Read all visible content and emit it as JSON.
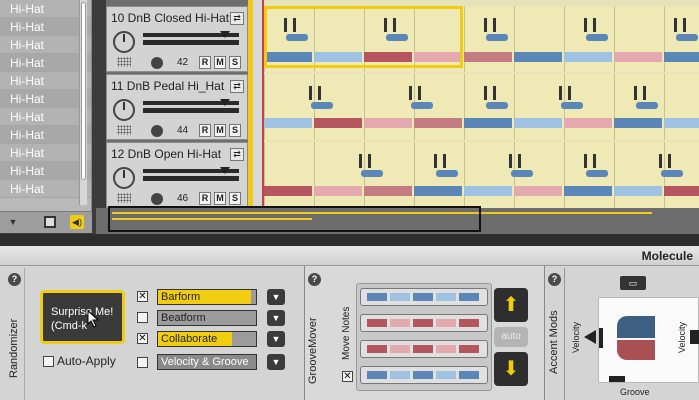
{
  "left_list": {
    "items": [
      "Hi-Hat",
      "Hi-Hat",
      "Hi-Hat",
      "Hi-Hat",
      "Hi-Hat",
      "Hi-Hat",
      "Hi-Hat",
      "Hi-Hat",
      "Hi-Hat",
      "Hi-Hat",
      "Hi-Hat"
    ]
  },
  "tracks": [
    {
      "name": "10 DnB Closed Hi-Hat",
      "value": "42",
      "r": "R",
      "m": "M",
      "s": "S"
    },
    {
      "name": "11 DnB Pedal Hi_Hat",
      "value": "44",
      "r": "R",
      "m": "M",
      "s": "S"
    },
    {
      "name": "12 DnB Open Hi-Hat",
      "value": "46",
      "r": "R",
      "m": "M",
      "s": "S"
    }
  ],
  "panel_title": "Molecule",
  "randomizer": {
    "label": "Randomizer",
    "surprise_line1": "Surprise Me!",
    "surprise_line2": "(Cmd-k",
    "auto_apply": "Auto-Apply",
    "options": [
      {
        "label": "Barform",
        "checked": true,
        "fill": 0.95
      },
      {
        "label": "Beatform",
        "checked": false,
        "fill": 0.0
      },
      {
        "label": "Collaborate",
        "checked": true,
        "fill": 0.75
      },
      {
        "label": "Velocity & Groove",
        "checked": false,
        "fill": 0.0
      }
    ]
  },
  "groovemover": {
    "label": "GrooveMover",
    "move_notes": "Move Notes",
    "auto": "auto"
  },
  "accent_mods": {
    "label": "Accent Mods",
    "velocity": "Velocity",
    "groove": "Groove"
  },
  "colors": {
    "accent": "#f0cd10",
    "blue": "#5a87b8",
    "red": "#b5555f"
  }
}
